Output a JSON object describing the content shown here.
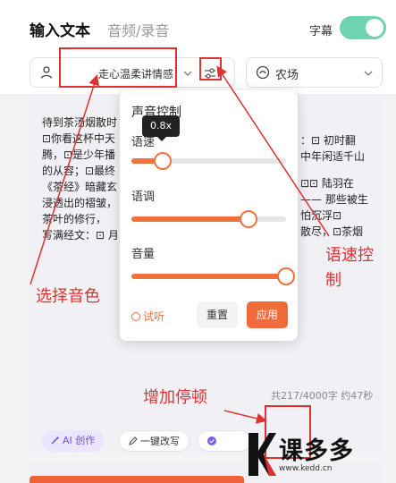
{
  "header": {
    "tab_active": "输入文本",
    "tab_inactive": "音频/录音",
    "subtitle_label": "字幕",
    "subtitle_on": true
  },
  "voice": {
    "name": "走心温柔讲情感",
    "scene": "农场"
  },
  "text_lines": [
    "待到茶汤烟散时",
    "⊡你看这杯中天",
    "腾，⊡是少年播",
    "的从容；⊡最终",
    "《茶经》暗藏玄",
    "浸透出的褶皱，",
    "    茶叶的修行，",
    "写满经文：⊡ 月"
  ],
  "text_right": [
    "：⊡ 初时翻",
    "中年闲适千山",
    "⊡⊡  陆羽在",
    "—— 那些被生",
    "怕沉浮⊡",
    "散尽，⊡茶烟"
  ],
  "counter": "共217/4000字 约47秒",
  "bottom": {
    "ai_label": "AI 创作",
    "rewrite_label": "一键改写",
    "pause_label": "增加停顿"
  },
  "popup": {
    "title": "声音控制",
    "speed_label": "语速",
    "speed_value_text": "0.8x",
    "speed_level": 0.2,
    "pitch_label": "语调",
    "pitch_level": 0.76,
    "volume_label": "音量",
    "volume_level": 1.0,
    "listen_label": "试听",
    "reset_label": "重置",
    "apply_label": "应用"
  },
  "annotations": {
    "select_voice": "选择音色",
    "speed_control": "语速控\n制",
    "add_pause": "增加停顿"
  },
  "watermark": {
    "main": "课多多",
    "sub": "www.kedd.cn"
  },
  "colors": {
    "accent": "#f06a3a",
    "annotation": "#e03030",
    "toggle": "#6fd3b2",
    "ai_chip": "#6b4ee6"
  }
}
